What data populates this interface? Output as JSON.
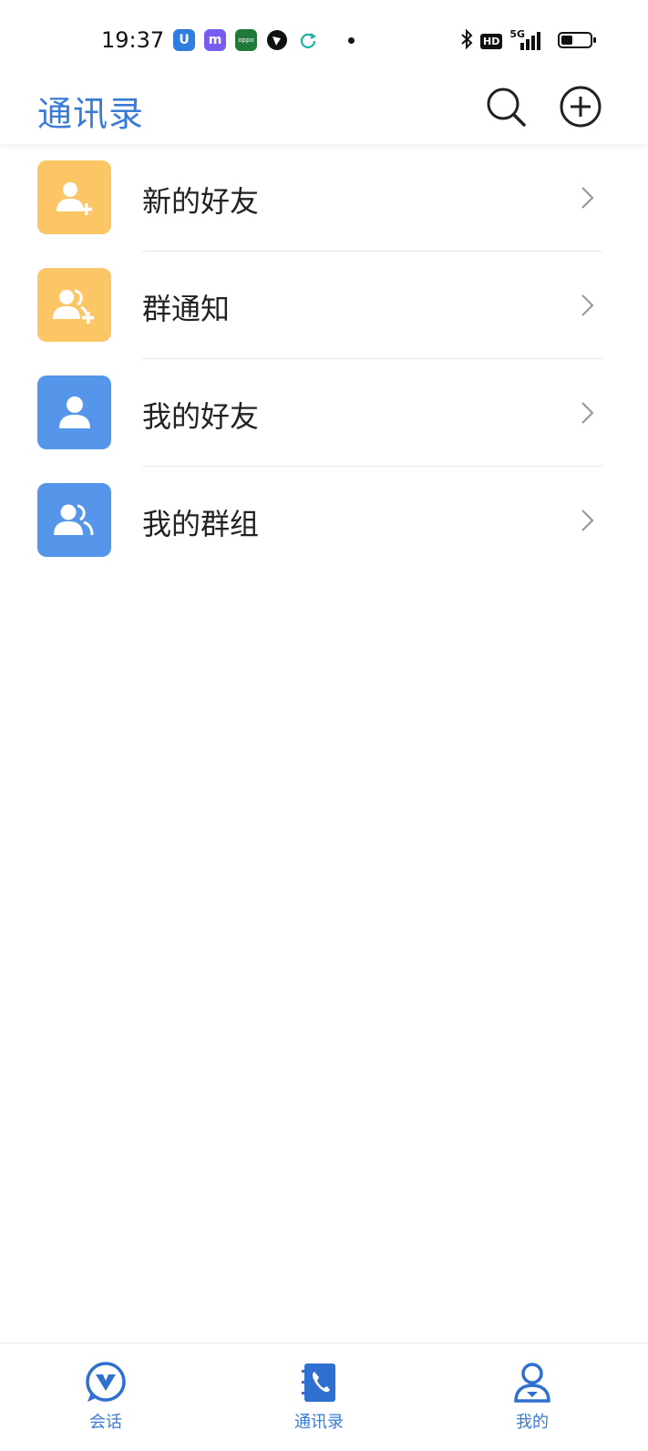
{
  "status_bar": {
    "time": "19:37",
    "app_icons": [
      {
        "name": "u-app-icon",
        "text": "U",
        "color": "#2f7de1"
      },
      {
        "name": "m-app-icon",
        "text": "m",
        "color": "#7b5cf0"
      },
      {
        "name": "oppo-app-icon",
        "text": "oppo",
        "color": "#1f7a3a"
      }
    ],
    "hd_label": "HD",
    "network_label": "5G",
    "battery_percent": 40
  },
  "header": {
    "title": "通讯录",
    "accent_color": "#3a7bd5"
  },
  "contacts_menu": [
    {
      "label": "新的好友",
      "icon": "user-add-icon",
      "color": "#fcc667"
    },
    {
      "label": "群通知",
      "icon": "group-add-icon",
      "color": "#fcc667"
    },
    {
      "label": "我的好友",
      "icon": "user-icon",
      "color": "#5595ea"
    },
    {
      "label": "我的群组",
      "icon": "group-icon",
      "color": "#5595ea"
    }
  ],
  "bottom_nav": {
    "tabs": [
      {
        "label": "会话",
        "icon": "chat-icon",
        "active": false
      },
      {
        "label": "通讯录",
        "icon": "contacts-book-icon",
        "active": true
      },
      {
        "label": "我的",
        "icon": "profile-icon",
        "active": false
      }
    ]
  }
}
